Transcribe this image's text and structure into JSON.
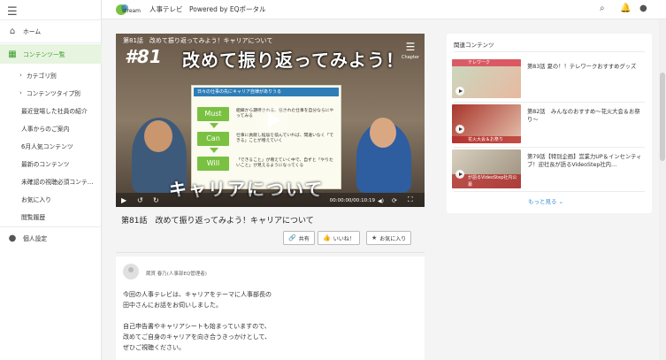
{
  "sidebar": {
    "items": [
      {
        "label": "ホーム"
      },
      {
        "label": "コンテンツ一覧"
      },
      {
        "label": "カテゴリ別"
      },
      {
        "label": "コンテンツタイプ別"
      },
      {
        "label": "最近登場した社員の紹介"
      },
      {
        "label": "人事からのご案内"
      },
      {
        "label": "6月人気コンテンツ"
      },
      {
        "label": "最新のコンテンツ"
      },
      {
        "label": "未確認の視聴必須コンテ…"
      },
      {
        "label": "お気に入り"
      },
      {
        "label": "閲覧履歴"
      },
      {
        "label": "個人設定"
      }
    ]
  },
  "header": {
    "logo_text": "stream",
    "brand": "人事テレビ　Powered by EQポータル"
  },
  "video": {
    "overlay_title": "第81話　改めて振り返ってみよう！キャリアについて",
    "episode": "#81",
    "headline": "改めて振り返ってみよう！",
    "caption": "キャリアについて",
    "slide_header": "日々の仕事の先にキャリア自律がありうる",
    "steps": [
      {
        "label": "Must",
        "text": "組織から期待される、任された仕事を自分ならにやってみる"
      },
      {
        "label": "Can",
        "text": "仕事に貢献し経験を積んでいれば、間違いなく「できる」ことが増えていく"
      },
      {
        "label": "Will",
        "text": "「できること」が増えていく中で、自ずと「やりたいこと」が見えるようになってくる"
      }
    ],
    "chapter_label": "Chapter",
    "timecode": "00:00:00/00:10:19",
    "title": "第81話　改めて振り返ってみよう！キャリアについて",
    "actions": {
      "share": "共有",
      "like": "いいね！",
      "favorite": "お気に入り"
    }
  },
  "comment": {
    "author": "蔵貫 春乃(人事部EQ管理者)",
    "lines": [
      "今回の人事テレビは、キャリアをテーマに人事部長の",
      "田中さんにお話をお伺いしました。",
      "",
      "自己申告書やキャリアシートも始まっていますので、",
      "改めてご自身のキャリアを向き合うきっかけとして、",
      "ぜひご視聴ください。"
    ]
  },
  "related": {
    "heading": "関連コンテンツ",
    "items": [
      {
        "title": "第83話 夏の！！テレワークおすすめグッズ",
        "thumb_caption": "テレワーク"
      },
      {
        "title": "第82話　みんなのおすすめ〜花火大会＆お祭り〜",
        "thumb_caption": "花火大会＆お祭り"
      },
      {
        "title": "第79話【特別企画】営業力UP＆インセンティブ！迎社長が語るVideoStep社内…",
        "thumb_caption": "が語るVideoStep社内公募"
      }
    ],
    "more": "もっと見る"
  },
  "colors": {
    "accent_green": "#3a9a2a",
    "link_blue": "#3a8fd8",
    "step_green": "#7ac142"
  }
}
